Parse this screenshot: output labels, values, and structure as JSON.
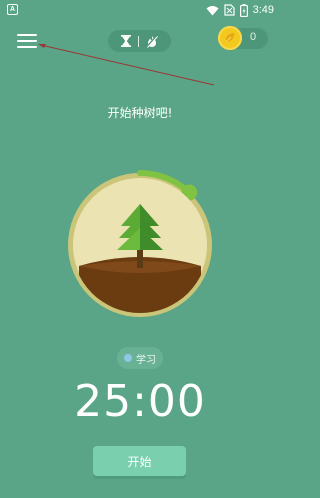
{
  "status_bar": {
    "app_icon_letter": "A",
    "time": "3:49"
  },
  "header": {
    "menu_icon": "hamburger-menu-icon",
    "mode_icons": [
      "hourglass-icon",
      "no-fire-icon"
    ],
    "coin_icon": "gold-coin-icon",
    "coin_count": "0"
  },
  "main": {
    "prompt": "开始种树吧!",
    "tag_label": "学习",
    "timer": "25:00",
    "start_button_label": "开始",
    "progress_arc_fraction": 0.12
  },
  "colors": {
    "background": "#5aa587",
    "ring_track": "#cbc57a",
    "ring_progress": "#80c241",
    "scene_fill": "#ece3b3",
    "soil": "#6b3c0f",
    "tree_green": "#5cab35",
    "coin": "#f3c81f",
    "start_button": "#79cfae"
  }
}
